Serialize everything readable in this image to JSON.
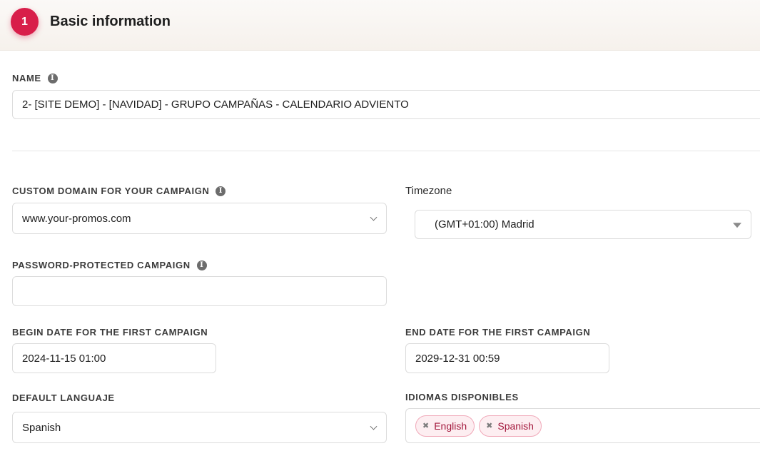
{
  "header": {
    "step": "1",
    "title": "Basic information"
  },
  "name": {
    "label": "NAME",
    "value": "2- [SITE DEMO] - [NAVIDAD] - GRUPO CAMPAÑAS - CALENDARIO ADVIENTO"
  },
  "custom_domain": {
    "label": "CUSTOM DOMAIN FOR YOUR CAMPAIGN",
    "value": "www.your-promos.com"
  },
  "timezone": {
    "label": "Timezone",
    "value": "(GMT+01:00) Madrid"
  },
  "password": {
    "label": "PASSWORD-PROTECTED CAMPAIGN",
    "value": ""
  },
  "begin_date": {
    "label": "BEGIN DATE FOR THE FIRST CAMPAIGN",
    "value": "2024-11-15 01:00"
  },
  "end_date": {
    "label": "END DATE FOR THE FIRST CAMPAIGN",
    "value": "2029-12-31 00:59"
  },
  "default_language": {
    "label": "DEFAULT LANGUAJE",
    "value": "Spanish"
  },
  "available_languages": {
    "label": "IDIOMAS DISPONIBLES",
    "chips": [
      "English",
      "Spanish"
    ]
  },
  "icons": {
    "info": "info-icon",
    "remove": "close-icon",
    "dropdown": "chevron-down-icon"
  },
  "colors": {
    "accent": "#d81e4a",
    "chip_bg": "#fdeef1",
    "chip_text": "#a3193d"
  }
}
